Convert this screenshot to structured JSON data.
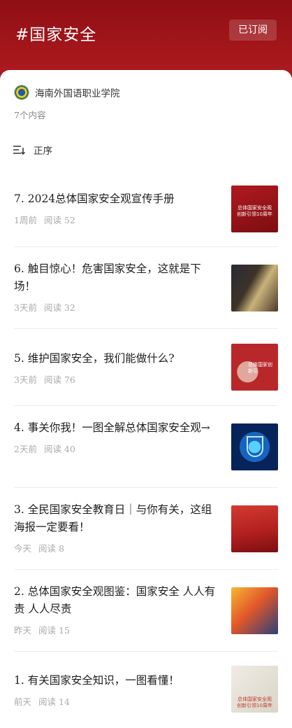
{
  "header": {
    "title": "#国家安全",
    "subscribe_label": "已订阅"
  },
  "source": {
    "name": "海南外国语职业学院",
    "count": "7个内容"
  },
  "sort": {
    "label": "正序"
  },
  "articles": [
    {
      "title": "7. 2024总体国家安全观宣传手册",
      "time": "1周前",
      "reads": "阅读 52",
      "thumb_text": "总体国家安全观创新引领10周年"
    },
    {
      "title": "6. 触目惊心！危害国家安全，这就是下场！",
      "time": "3天前",
      "reads": "阅读 32",
      "thumb_text": ""
    },
    {
      "title": "5. 维护国家安全，我们能做什么?",
      "time": "3天前",
      "reads": "阅读 76",
      "thumb_text": "总体国家创新引"
    },
    {
      "title": "4. 事关你我！一图全解总体国家安全观→",
      "time": "2天前",
      "reads": "阅读 40",
      "thumb_text": ""
    },
    {
      "title": "3. 全民国家安全教育日｜与你有关，这组海报一定要看！",
      "time": "今天",
      "reads": "阅读 8",
      "thumb_text": ""
    },
    {
      "title": "2. 总体国家安全观图鉴：国家安全 人人有责 人人尽责",
      "time": "昨天",
      "reads": "阅读 15",
      "thumb_text": ""
    },
    {
      "title": "1. 有关国家安全知识，一图看懂！",
      "time": "前天",
      "reads": "阅读 14",
      "thumb_text": "总体国家安全观创新引领10周年"
    }
  ],
  "colors": {
    "brand": "#a4161b",
    "meta": "#aaaaaa"
  }
}
